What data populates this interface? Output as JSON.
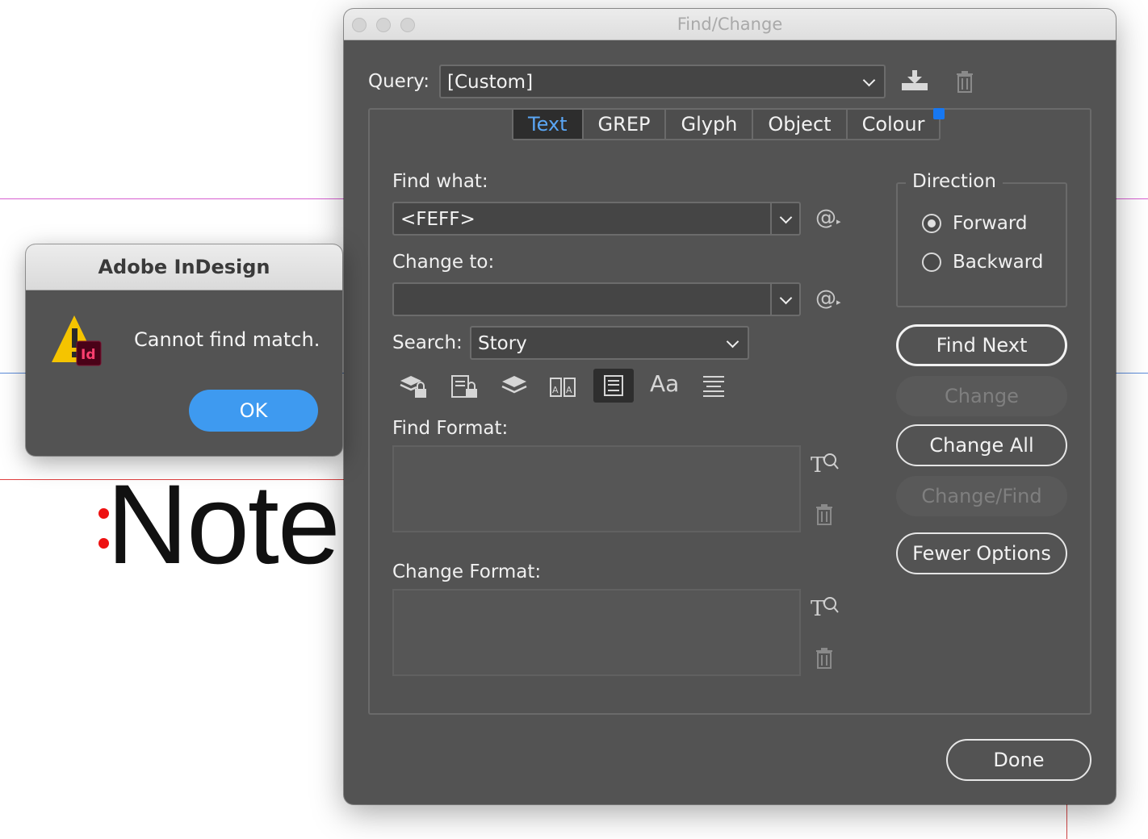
{
  "document": {
    "text": "Note"
  },
  "find_change": {
    "title": "Find/Change",
    "query_label": "Query:",
    "query_value": "[Custom]",
    "tabs": [
      {
        "label": "Text",
        "active": true
      },
      {
        "label": "GREP",
        "active": false
      },
      {
        "label": "Glyph",
        "active": false
      },
      {
        "label": "Object",
        "active": false
      },
      {
        "label": "Colour",
        "active": false
      }
    ],
    "find_what_label": "Find what:",
    "find_what_value": "<FEFF>",
    "change_to_label": "Change to:",
    "change_to_value": "",
    "search_label": "Search:",
    "search_value": "Story",
    "special_char_symbol": "@",
    "text_size_symbol": "Aa",
    "find_format_label": "Find Format:",
    "change_format_label": "Change Format:",
    "direction_label": "Direction",
    "direction_options": [
      {
        "label": "Forward",
        "selected": true
      },
      {
        "label": "Backward",
        "selected": false
      }
    ],
    "buttons": {
      "find_next": "Find Next",
      "change": "Change",
      "change_all": "Change All",
      "change_find": "Change/Find",
      "fewer_options": "Fewer Options",
      "done": "Done"
    },
    "colors": {
      "panel": "#535353",
      "active_tab_text": "#5aa6f5",
      "tab_marker": "#1778f2"
    }
  },
  "alert": {
    "title": "Adobe InDesign",
    "message": "Cannot find match.",
    "app_badge": "Id",
    "ok_label": "OK",
    "colors": {
      "ok_button": "#3e9af0",
      "warning": "#f5c400",
      "badge": "#4a0218"
    }
  }
}
